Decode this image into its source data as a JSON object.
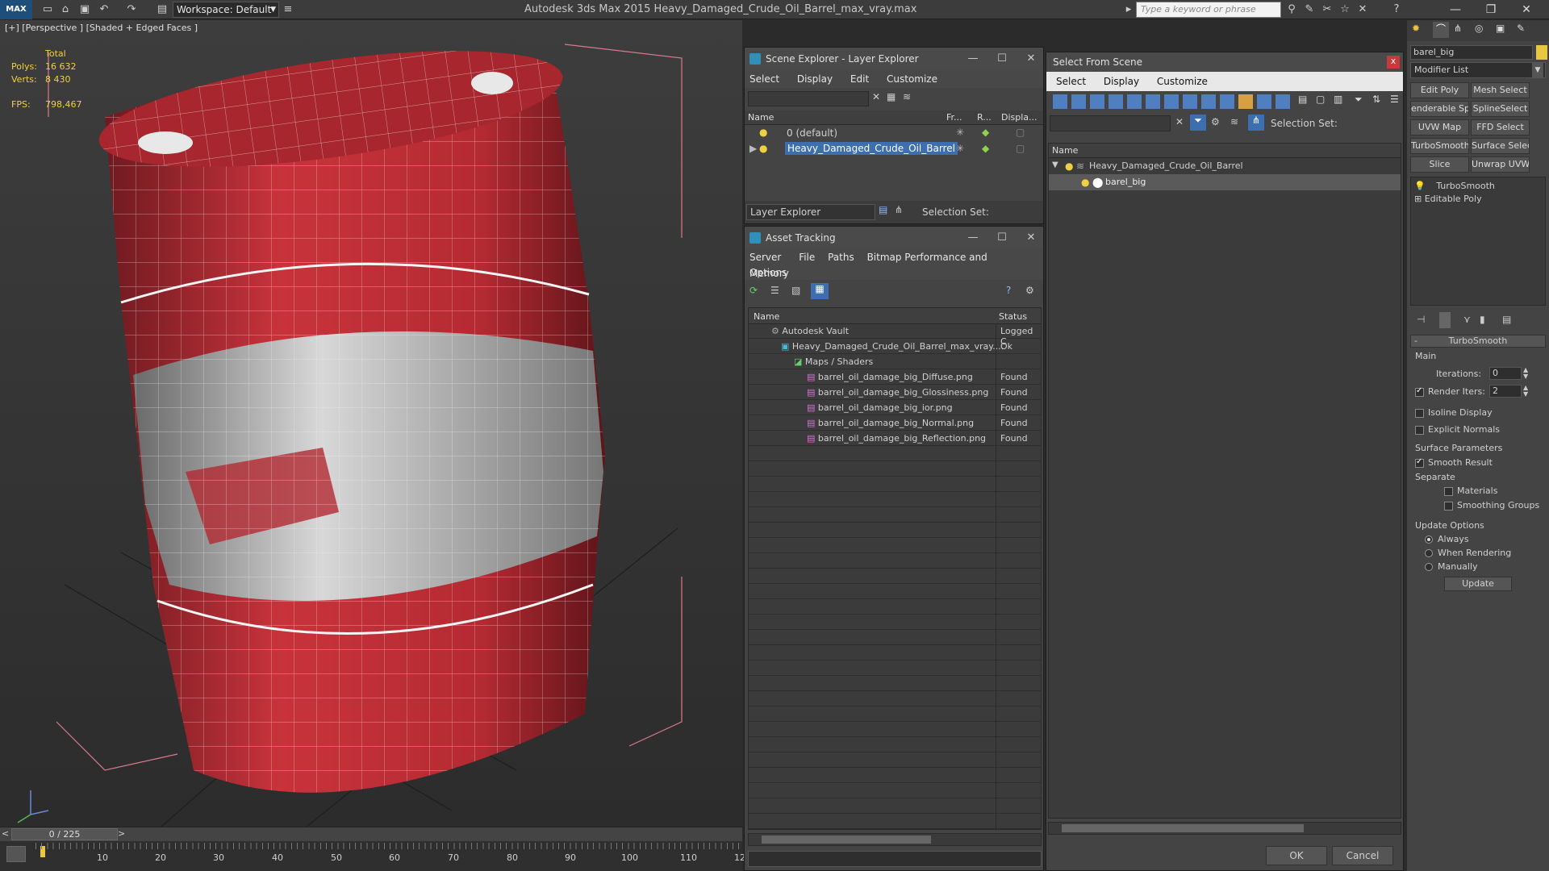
{
  "titlebar": {
    "app_badge": "MAX",
    "workspace": "Workspace: Default",
    "title": "Autodesk 3ds Max 2015     Heavy_Damaged_Crude_Oil_Barrel_max_vray.max",
    "search_placeholder": "Type a keyword or phrase"
  },
  "viewport": {
    "label": "[+] [Perspective ] [Shaded + Edged Faces ]",
    "stats": {
      "total_label": "Total",
      "polys_label": "Polys:",
      "polys_value": "16 632",
      "verts_label": "Verts:",
      "verts_value": "8 430",
      "fps_label": "FPS:",
      "fps_value": "798,467"
    }
  },
  "timeline": {
    "slider": "0 / 225",
    "prev": "<",
    "next": ">",
    "ticks": [
      "10",
      "20",
      "30",
      "40",
      "50",
      "60",
      "70",
      "80",
      "90",
      "100",
      "110",
      "12"
    ]
  },
  "scene_explorer": {
    "title": "Scene Explorer - Layer Explorer",
    "menu": [
      "Select",
      "Display",
      "Edit",
      "Customize"
    ],
    "columns": [
      "Name",
      "Fr...",
      "R...",
      "Displa..."
    ],
    "rows": [
      "0 (default)",
      "Heavy_Damaged_Crude_Oil_Barrel"
    ],
    "footer_dropdown": "Layer Explorer",
    "selection_set_label": "Selection Set:"
  },
  "asset_tracking": {
    "title": "Asset Tracking",
    "menu": [
      "Server",
      "File",
      "Paths",
      "Bitmap Performance and Memory"
    ],
    "menu2": "Options",
    "columns": [
      "Name",
      "Status"
    ],
    "rows": [
      {
        "name": "Autodesk Vault",
        "status": "Logged C"
      },
      {
        "name": "Heavy_Damaged_Crude_Oil_Barrel_max_vray....",
        "status": "Ok"
      },
      {
        "name": "Maps / Shaders",
        "status": ""
      },
      {
        "name": "barrel_oil_damage_big_Diffuse.png",
        "status": "Found"
      },
      {
        "name": "barrel_oil_damage_big_Glossiness.png",
        "status": "Found"
      },
      {
        "name": "barrel_oil_damage_big_ior.png",
        "status": "Found"
      },
      {
        "name": "barrel_oil_damage_big_Normal.png",
        "status": "Found"
      },
      {
        "name": "barrel_oil_damage_big_Reflection.png",
        "status": "Found"
      }
    ]
  },
  "select_from_scene": {
    "title": "Select From Scene",
    "close": "x",
    "menu": [
      "Select",
      "Display",
      "Customize"
    ],
    "selection_set_label": "Selection Set:",
    "column": "Name",
    "tree": [
      "Heavy_Damaged_Crude_Oil_Barrel",
      "barel_big"
    ],
    "ok": "OK",
    "cancel": "Cancel"
  },
  "command_panel": {
    "object_name": "barel_big",
    "modifier_list": "Modifier List",
    "buttons": [
      "Edit Poly",
      "Mesh Select",
      "enderable Splir",
      "SplineSelect",
      "UVW Map",
      "FFD Select",
      "TurboSmooth",
      "Surface Select",
      "Slice",
      "Unwrap UVW"
    ],
    "stack": [
      "TurboSmooth",
      "Editable Poly"
    ],
    "rollout_title": "TurboSmooth",
    "main_label": "Main",
    "iterations_label": "Iterations:",
    "iterations_value": "0",
    "render_iters_label": "Render Iters:",
    "render_iters_value": "2",
    "isoline_label": "Isoline Display",
    "explicit_normals_label": "Explicit Normals",
    "surface_params_label": "Surface Parameters",
    "smooth_result_label": "Smooth Result",
    "separate_label": "Separate",
    "materials_label": "Materials",
    "smoothing_groups_label": "Smoothing Groups",
    "update_options_label": "Update Options",
    "always_label": "Always",
    "when_rendering_label": "When Rendering",
    "manually_label": "Manually",
    "update_button": "Update"
  }
}
